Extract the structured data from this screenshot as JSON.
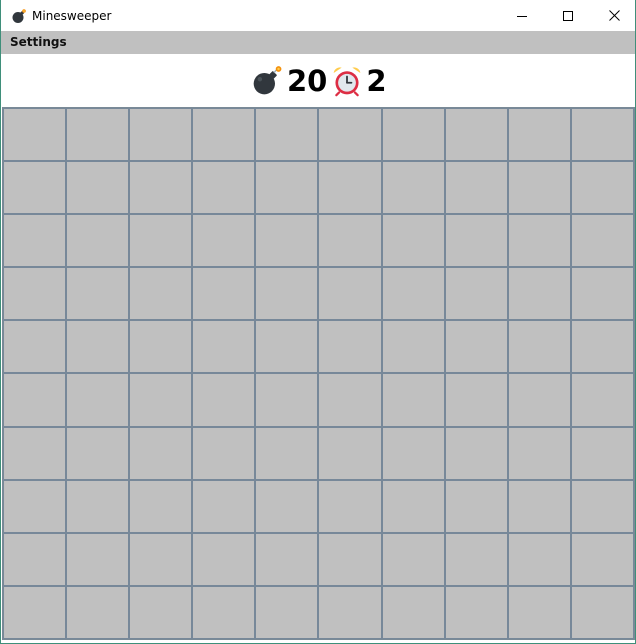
{
  "window": {
    "title": "Minesweeper",
    "icon": "bomb-icon"
  },
  "menu": {
    "items": [
      {
        "label": "Settings"
      }
    ]
  },
  "status": {
    "mines_remaining": "20",
    "mine_icon": "bomb-icon",
    "timer_icon": "alarm-clock-icon",
    "elapsed_seconds": "2"
  },
  "board": {
    "rows": 10,
    "cols": 10,
    "cell_state": "unrevealed",
    "cell_color": "#c0c0c0",
    "grid_line_color": "#778899"
  }
}
